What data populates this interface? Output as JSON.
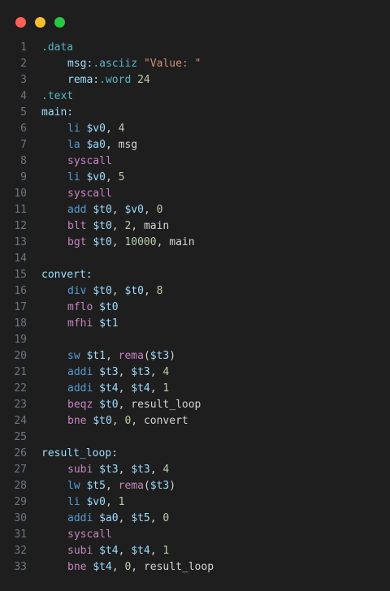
{
  "window": {
    "buttons": {
      "close_color": "#ff5f57",
      "minimize_color": "#febc2e",
      "maximize_color": "#28c840"
    }
  },
  "editor": {
    "lines": [
      {
        "n": "1",
        "indent": 0,
        "tokens": [
          {
            "t": ".data",
            "k": "dir"
          }
        ]
      },
      {
        "n": "2",
        "indent": 1,
        "tokens": [
          {
            "t": "msg:",
            "k": "label"
          },
          {
            "t": ".asciiz",
            "k": "dir"
          },
          {
            "t": " ",
            "k": "plain"
          },
          {
            "t": "\"Value: \"",
            "k": "str"
          }
        ]
      },
      {
        "n": "3",
        "indent": 1,
        "tokens": [
          {
            "t": "rema:",
            "k": "label"
          },
          {
            "t": ".word",
            "k": "dir"
          },
          {
            "t": " ",
            "k": "plain"
          },
          {
            "t": "24",
            "k": "num"
          }
        ]
      },
      {
        "n": "4",
        "indent": 0,
        "tokens": [
          {
            "t": ".text",
            "k": "dir"
          }
        ]
      },
      {
        "n": "5",
        "indent": 0,
        "tokens": [
          {
            "t": "main:",
            "k": "label"
          }
        ]
      },
      {
        "n": "6",
        "indent": 1,
        "tokens": [
          {
            "t": "li",
            "k": "instr"
          },
          {
            "t": " ",
            "k": "plain"
          },
          {
            "t": "$v0",
            "k": "reg"
          },
          {
            "t": ", ",
            "k": "punc"
          },
          {
            "t": "4",
            "k": "num"
          }
        ]
      },
      {
        "n": "7",
        "indent": 1,
        "tokens": [
          {
            "t": "la",
            "k": "instr"
          },
          {
            "t": " ",
            "k": "plain"
          },
          {
            "t": "$a0",
            "k": "reg"
          },
          {
            "t": ", ",
            "k": "punc"
          },
          {
            "t": "msg",
            "k": "id"
          }
        ]
      },
      {
        "n": "8",
        "indent": 1,
        "tokens": [
          {
            "t": "syscall",
            "k": "kw"
          }
        ]
      },
      {
        "n": "9",
        "indent": 1,
        "tokens": [
          {
            "t": "li",
            "k": "instr"
          },
          {
            "t": " ",
            "k": "plain"
          },
          {
            "t": "$v0",
            "k": "reg"
          },
          {
            "t": ", ",
            "k": "punc"
          },
          {
            "t": "5",
            "k": "num"
          }
        ]
      },
      {
        "n": "10",
        "indent": 1,
        "tokens": [
          {
            "t": "syscall",
            "k": "kw"
          }
        ]
      },
      {
        "n": "11",
        "indent": 1,
        "tokens": [
          {
            "t": "add",
            "k": "instr"
          },
          {
            "t": " ",
            "k": "plain"
          },
          {
            "t": "$t0",
            "k": "reg"
          },
          {
            "t": ", ",
            "k": "punc"
          },
          {
            "t": "$v0",
            "k": "reg"
          },
          {
            "t": ", ",
            "k": "punc"
          },
          {
            "t": "0",
            "k": "num"
          }
        ]
      },
      {
        "n": "12",
        "indent": 1,
        "tokens": [
          {
            "t": "blt",
            "k": "kw"
          },
          {
            "t": " ",
            "k": "plain"
          },
          {
            "t": "$t0",
            "k": "reg"
          },
          {
            "t": ", ",
            "k": "punc"
          },
          {
            "t": "2",
            "k": "num"
          },
          {
            "t": ", ",
            "k": "punc"
          },
          {
            "t": "main",
            "k": "id"
          }
        ]
      },
      {
        "n": "13",
        "indent": 1,
        "tokens": [
          {
            "t": "bgt",
            "k": "kw"
          },
          {
            "t": " ",
            "k": "plain"
          },
          {
            "t": "$t0",
            "k": "reg"
          },
          {
            "t": ", ",
            "k": "punc"
          },
          {
            "t": "10000",
            "k": "num"
          },
          {
            "t": ", ",
            "k": "punc"
          },
          {
            "t": "main",
            "k": "id"
          }
        ]
      },
      {
        "n": "14",
        "indent": 0,
        "tokens": []
      },
      {
        "n": "15",
        "indent": 0,
        "tokens": [
          {
            "t": "convert:",
            "k": "label"
          }
        ]
      },
      {
        "n": "16",
        "indent": 1,
        "tokens": [
          {
            "t": "div",
            "k": "instr"
          },
          {
            "t": " ",
            "k": "plain"
          },
          {
            "t": "$t0",
            "k": "reg"
          },
          {
            "t": ", ",
            "k": "punc"
          },
          {
            "t": "$t0",
            "k": "reg"
          },
          {
            "t": ", ",
            "k": "punc"
          },
          {
            "t": "8",
            "k": "num"
          }
        ]
      },
      {
        "n": "17",
        "indent": 1,
        "tokens": [
          {
            "t": "mflo",
            "k": "kw"
          },
          {
            "t": " ",
            "k": "plain"
          },
          {
            "t": "$t0",
            "k": "reg"
          }
        ]
      },
      {
        "n": "18",
        "indent": 1,
        "tokens": [
          {
            "t": "mfhi",
            "k": "kw"
          },
          {
            "t": " ",
            "k": "plain"
          },
          {
            "t": "$t1",
            "k": "reg"
          }
        ]
      },
      {
        "n": "19",
        "indent": 0,
        "tokens": []
      },
      {
        "n": "20",
        "indent": 1,
        "tokens": [
          {
            "t": "sw",
            "k": "instr"
          },
          {
            "t": " ",
            "k": "plain"
          },
          {
            "t": "$t1",
            "k": "reg"
          },
          {
            "t": ", ",
            "k": "punc"
          },
          {
            "t": "rema",
            "k": "kw"
          },
          {
            "t": "(",
            "k": "punc"
          },
          {
            "t": "$t3",
            "k": "reg"
          },
          {
            "t": ")",
            "k": "punc"
          }
        ]
      },
      {
        "n": "21",
        "indent": 1,
        "tokens": [
          {
            "t": "addi",
            "k": "instr"
          },
          {
            "t": " ",
            "k": "plain"
          },
          {
            "t": "$t3",
            "k": "reg"
          },
          {
            "t": ", ",
            "k": "punc"
          },
          {
            "t": "$t3",
            "k": "reg"
          },
          {
            "t": ", ",
            "k": "punc"
          },
          {
            "t": "4",
            "k": "num"
          }
        ]
      },
      {
        "n": "22",
        "indent": 1,
        "tokens": [
          {
            "t": "addi",
            "k": "instr"
          },
          {
            "t": " ",
            "k": "plain"
          },
          {
            "t": "$t4",
            "k": "reg"
          },
          {
            "t": ", ",
            "k": "punc"
          },
          {
            "t": "$t4",
            "k": "reg"
          },
          {
            "t": ", ",
            "k": "punc"
          },
          {
            "t": "1",
            "k": "num"
          }
        ]
      },
      {
        "n": "23",
        "indent": 1,
        "tokens": [
          {
            "t": "beqz",
            "k": "kw"
          },
          {
            "t": " ",
            "k": "plain"
          },
          {
            "t": "$t0",
            "k": "reg"
          },
          {
            "t": ", ",
            "k": "punc"
          },
          {
            "t": "result_loop",
            "k": "id"
          }
        ]
      },
      {
        "n": "24",
        "indent": 1,
        "tokens": [
          {
            "t": "bne",
            "k": "kw"
          },
          {
            "t": " ",
            "k": "plain"
          },
          {
            "t": "$t0",
            "k": "reg"
          },
          {
            "t": ", ",
            "k": "punc"
          },
          {
            "t": "0",
            "k": "num"
          },
          {
            "t": ", ",
            "k": "punc"
          },
          {
            "t": "convert",
            "k": "id"
          }
        ]
      },
      {
        "n": "25",
        "indent": 0,
        "tokens": []
      },
      {
        "n": "26",
        "indent": 0,
        "tokens": [
          {
            "t": "result_loop:",
            "k": "label"
          }
        ]
      },
      {
        "n": "27",
        "indent": 1,
        "tokens": [
          {
            "t": "subi",
            "k": "kw"
          },
          {
            "t": " ",
            "k": "plain"
          },
          {
            "t": "$t3",
            "k": "reg"
          },
          {
            "t": ", ",
            "k": "punc"
          },
          {
            "t": "$t3",
            "k": "reg"
          },
          {
            "t": ", ",
            "k": "punc"
          },
          {
            "t": "4",
            "k": "num"
          }
        ]
      },
      {
        "n": "28",
        "indent": 1,
        "tokens": [
          {
            "t": "lw",
            "k": "instr"
          },
          {
            "t": " ",
            "k": "plain"
          },
          {
            "t": "$t5",
            "k": "reg"
          },
          {
            "t": ", ",
            "k": "punc"
          },
          {
            "t": "rema",
            "k": "kw"
          },
          {
            "t": "(",
            "k": "punc"
          },
          {
            "t": "$t3",
            "k": "reg"
          },
          {
            "t": ")",
            "k": "punc"
          }
        ]
      },
      {
        "n": "29",
        "indent": 1,
        "tokens": [
          {
            "t": "li",
            "k": "instr"
          },
          {
            "t": " ",
            "k": "plain"
          },
          {
            "t": "$v0",
            "k": "reg"
          },
          {
            "t": ", ",
            "k": "punc"
          },
          {
            "t": "1",
            "k": "num"
          }
        ]
      },
      {
        "n": "30",
        "indent": 1,
        "tokens": [
          {
            "t": "addi",
            "k": "instr"
          },
          {
            "t": " ",
            "k": "plain"
          },
          {
            "t": "$a0",
            "k": "reg"
          },
          {
            "t": ", ",
            "k": "punc"
          },
          {
            "t": "$t5",
            "k": "reg"
          },
          {
            "t": ", ",
            "k": "punc"
          },
          {
            "t": "0",
            "k": "num"
          }
        ]
      },
      {
        "n": "31",
        "indent": 1,
        "tokens": [
          {
            "t": "syscall",
            "k": "kw"
          }
        ]
      },
      {
        "n": "32",
        "indent": 1,
        "tokens": [
          {
            "t": "subi",
            "k": "kw"
          },
          {
            "t": " ",
            "k": "plain"
          },
          {
            "t": "$t4",
            "k": "reg"
          },
          {
            "t": ", ",
            "k": "punc"
          },
          {
            "t": "$t4",
            "k": "reg"
          },
          {
            "t": ", ",
            "k": "punc"
          },
          {
            "t": "1",
            "k": "num"
          }
        ]
      },
      {
        "n": "33",
        "indent": 1,
        "tokens": [
          {
            "t": "bne",
            "k": "kw"
          },
          {
            "t": " ",
            "k": "plain"
          },
          {
            "t": "$t4",
            "k": "reg"
          },
          {
            "t": ", ",
            "k": "punc"
          },
          {
            "t": "0",
            "k": "num"
          },
          {
            "t": ", ",
            "k": "punc"
          },
          {
            "t": "result_loop",
            "k": "id"
          }
        ]
      }
    ]
  }
}
